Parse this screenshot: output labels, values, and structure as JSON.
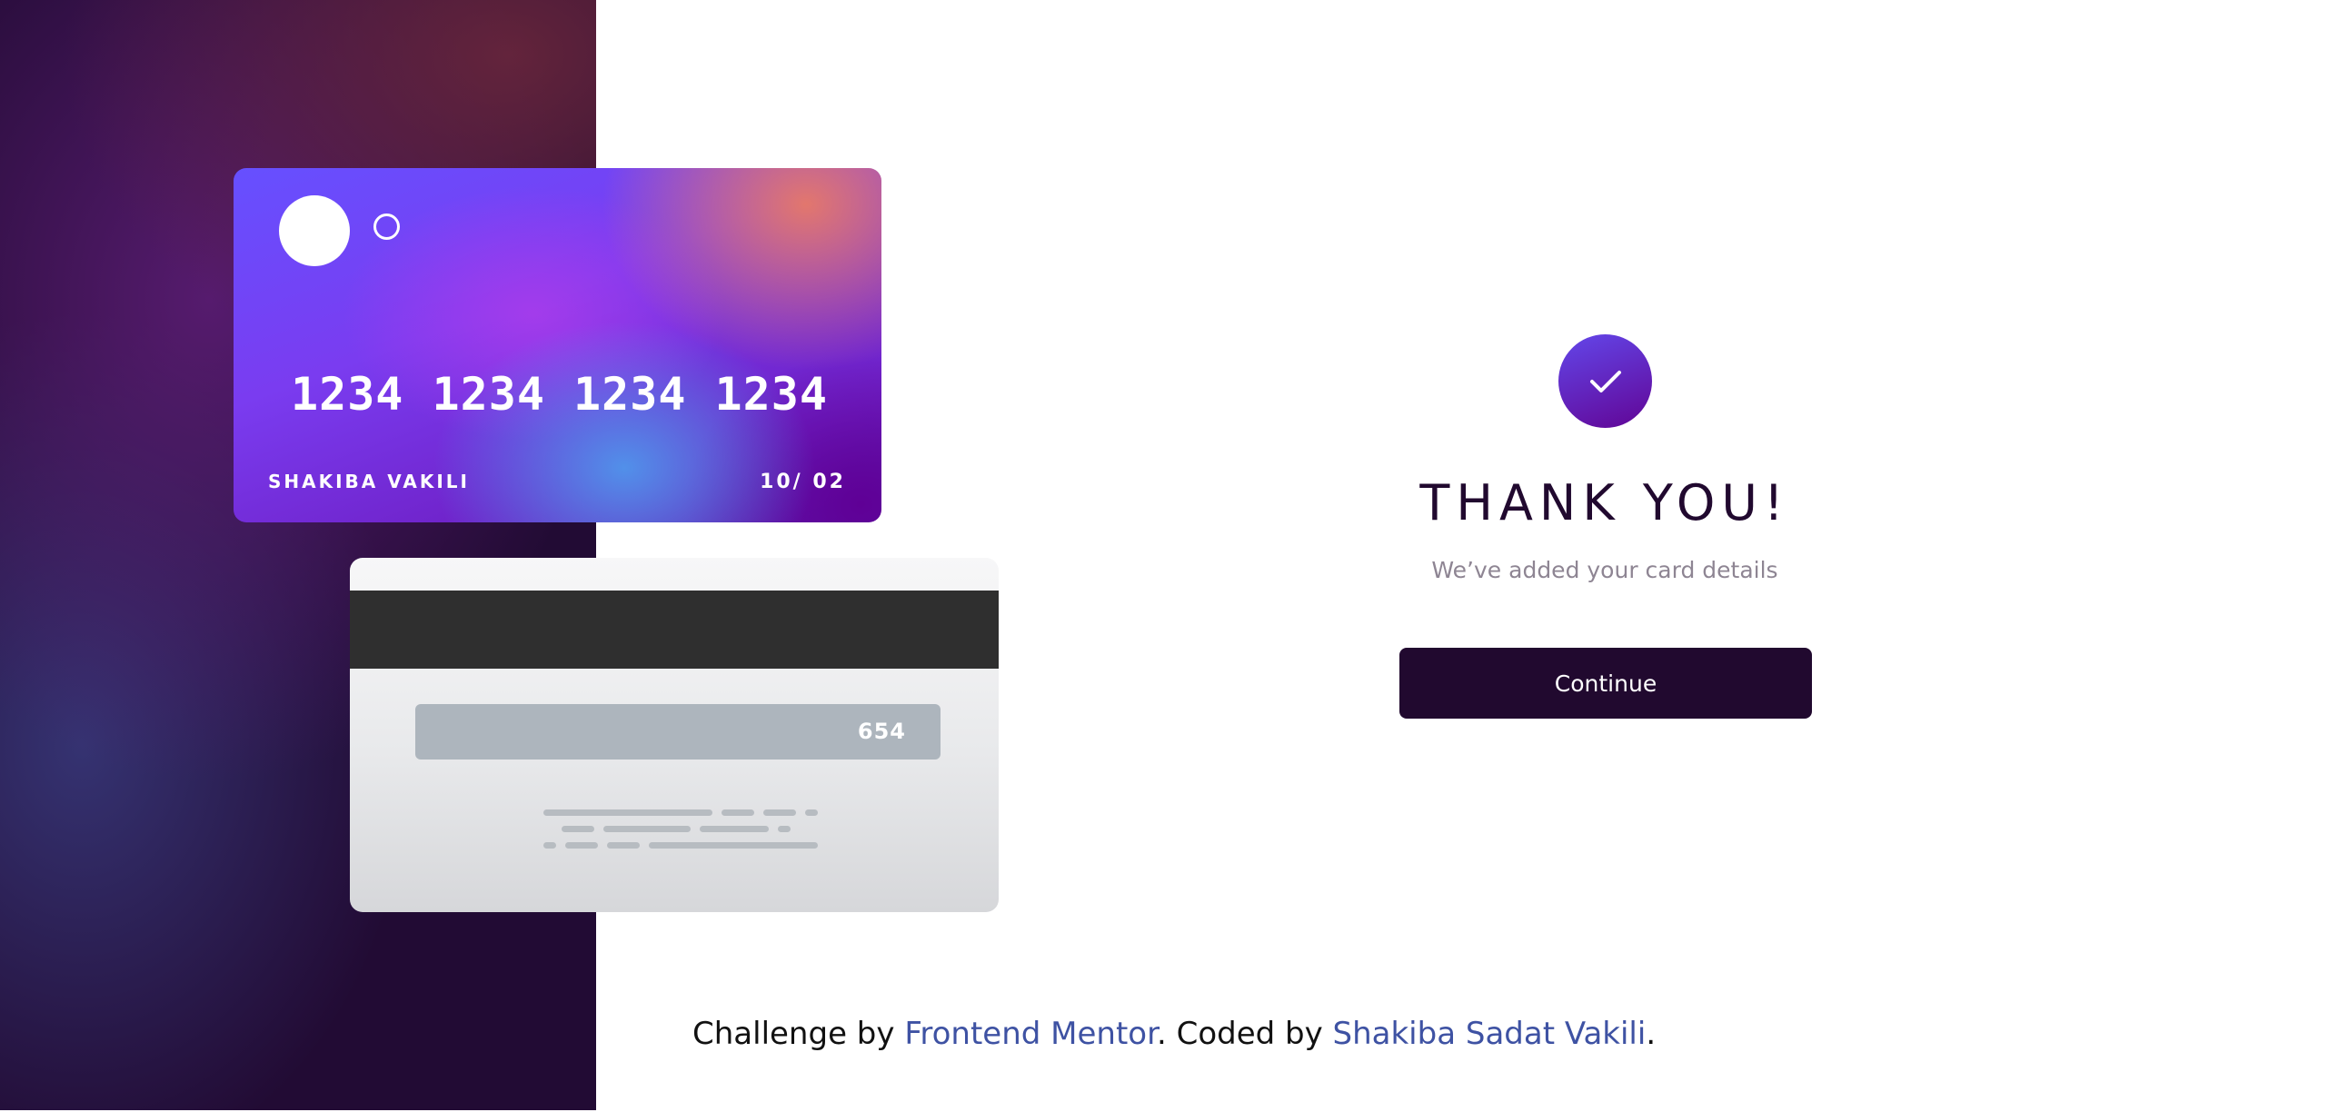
{
  "card_front": {
    "number": "1234 1234 1234 1234",
    "holder": "SHAKIBA VAKILI",
    "expiry": "10/ 02"
  },
  "card_back": {
    "cvc": "654"
  },
  "complete": {
    "icon": "checkmark-icon",
    "title": "THANK YOU!",
    "subtitle": "We’ve added your card details",
    "continue_label": "Continue"
  },
  "attribution": {
    "prefix": "Challenge by ",
    "frontend_mentor": "Frontend Mentor",
    "middle": ". Coded by ",
    "author": "Shakiba Sadat Vakili",
    "suffix": "."
  },
  "colors": {
    "dark_violet": "#21092f",
    "accent_gradient_start": "#6347ea",
    "accent_gradient_end": "#610595",
    "link": "#3e52a3",
    "muted_text": "#8e8593"
  }
}
